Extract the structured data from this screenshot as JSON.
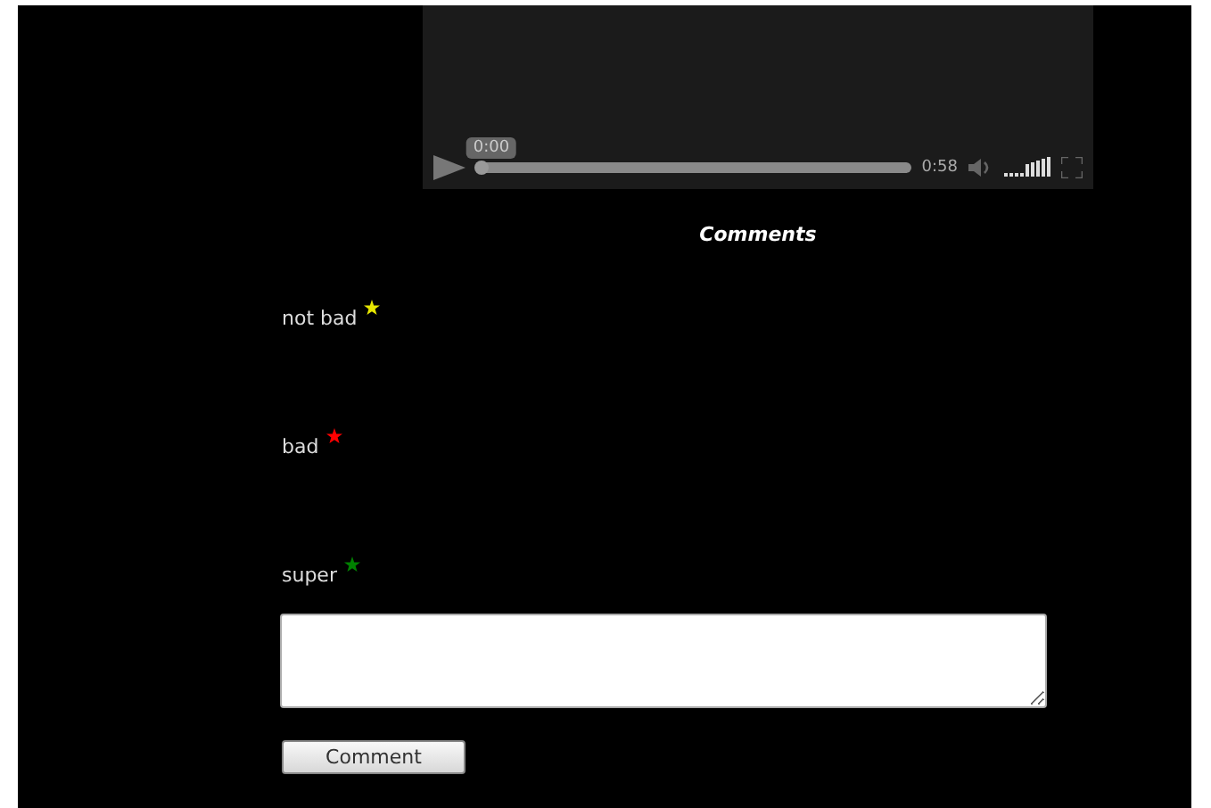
{
  "video": {
    "current_time": "0:00",
    "duration": "0:58",
    "progress": {
      "level": 0
    },
    "volume": {
      "level": 1
    }
  },
  "comments_heading": "Comments",
  "comments": [
    {
      "text": "not bad",
      "color": "#e6e600"
    },
    {
      "text": "bad",
      "color": "#ff0000"
    },
    {
      "text": "super",
      "color": "#008000"
    }
  ],
  "comment_button": "Comment"
}
